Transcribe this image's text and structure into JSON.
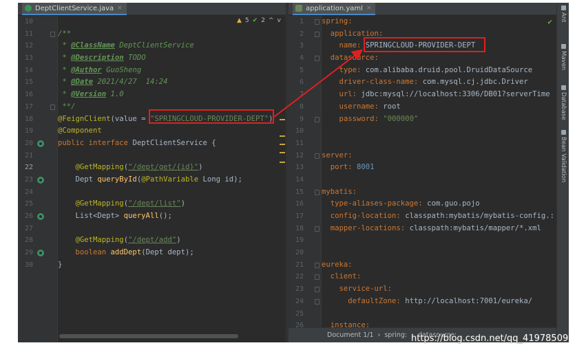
{
  "left_tab": {
    "label": "DeptClientService.java",
    "close": "×"
  },
  "right_tab": {
    "label": "application.yaml",
    "close": "×"
  },
  "inspections": {
    "warnings": "5",
    "ok": "2",
    "up": "^",
    "down": "v"
  },
  "right_check": "✔",
  "java_lines": [
    {
      "n": "10",
      "parts": []
    },
    {
      "n": "11",
      "parts": [
        {
          "c": "c-doc",
          "t": "/**"
        }
      ]
    },
    {
      "n": "12",
      "parts": [
        {
          "c": "c-doc",
          "t": " * "
        },
        {
          "c": "c-tag",
          "t": "@ClassName"
        },
        {
          "c": "c-doc",
          "t": " DeptClientService"
        }
      ]
    },
    {
      "n": "13",
      "parts": [
        {
          "c": "c-doc",
          "t": " * "
        },
        {
          "c": "c-tag",
          "t": "@Description"
        },
        {
          "c": "c-doc",
          "t": " TODO"
        }
      ]
    },
    {
      "n": "14",
      "parts": [
        {
          "c": "c-doc",
          "t": " * "
        },
        {
          "c": "c-tag",
          "t": "@Author"
        },
        {
          "c": "c-doc",
          "t": " GuoSheng"
        }
      ]
    },
    {
      "n": "15",
      "parts": [
        {
          "c": "c-doc",
          "t": " * "
        },
        {
          "c": "c-tag",
          "t": "@Date"
        },
        {
          "c": "c-doc",
          "t": " 2021/4/27  14:24"
        }
      ]
    },
    {
      "n": "16",
      "parts": [
        {
          "c": "c-doc",
          "t": " * "
        },
        {
          "c": "c-tag",
          "t": "@Version"
        },
        {
          "c": "c-doc",
          "t": " 1.0"
        }
      ]
    },
    {
      "n": "17",
      "parts": [
        {
          "c": "c-doc",
          "t": " **/"
        }
      ]
    },
    {
      "n": "18",
      "parts": [
        {
          "c": "c-ann",
          "t": "@FeignClient"
        },
        {
          "c": "",
          "t": "(value = "
        },
        {
          "c": "c-str",
          "t": "\"SPRINGCLOUD-PROVIDER-DEPT\""
        },
        {
          "c": "",
          "t": ")"
        }
      ]
    },
    {
      "n": "19",
      "parts": [
        {
          "c": "c-ann",
          "t": "@Component"
        }
      ]
    },
    {
      "n": "20",
      "icon": true,
      "parts": [
        {
          "c": "c-kw",
          "t": "public interface "
        },
        {
          "c": "",
          "t": "DeptClientService {"
        }
      ]
    },
    {
      "n": "21",
      "parts": []
    },
    {
      "n": "22",
      "cur": true,
      "parts": [
        {
          "c": "",
          "t": "    "
        },
        {
          "c": "c-ann",
          "t": "@GetMapping"
        },
        {
          "c": "",
          "t": "("
        },
        {
          "c": "c-link",
          "t": "\"/dept/get/{id}\""
        },
        {
          "c": "",
          "t": ")"
        }
      ]
    },
    {
      "n": "23",
      "icon": true,
      "parts": [
        {
          "c": "",
          "t": "    Dept "
        },
        {
          "c": "c-fn",
          "t": "queryById"
        },
        {
          "c": "",
          "t": "("
        },
        {
          "c": "c-ann",
          "t": "@PathVariable"
        },
        {
          "c": "",
          "t": " Long id);"
        }
      ]
    },
    {
      "n": "24",
      "parts": []
    },
    {
      "n": "25",
      "parts": [
        {
          "c": "",
          "t": "    "
        },
        {
          "c": "c-ann",
          "t": "@GetMapping"
        },
        {
          "c": "",
          "t": "("
        },
        {
          "c": "c-link",
          "t": "\"/dept/list\""
        },
        {
          "c": "",
          "t": ")"
        }
      ]
    },
    {
      "n": "26",
      "icon": true,
      "parts": [
        {
          "c": "",
          "t": "    List<Dept> "
        },
        {
          "c": "c-fn",
          "t": "queryAll"
        },
        {
          "c": "",
          "t": "();"
        }
      ]
    },
    {
      "n": "27",
      "parts": []
    },
    {
      "n": "28",
      "parts": [
        {
          "c": "",
          "t": "    "
        },
        {
          "c": "c-ann",
          "t": "@GetMapping"
        },
        {
          "c": "",
          "t": "("
        },
        {
          "c": "c-link",
          "t": "\"/dept/add\""
        },
        {
          "c": "",
          "t": ")"
        }
      ]
    },
    {
      "n": "29",
      "icon": true,
      "parts": [
        {
          "c": "",
          "t": "    "
        },
        {
          "c": "c-kw",
          "t": "boolean "
        },
        {
          "c": "c-fn",
          "t": "addDept"
        },
        {
          "c": "",
          "t": "(Dept dept);"
        }
      ]
    },
    {
      "n": "30",
      "parts": [
        {
          "c": "",
          "t": "}"
        }
      ]
    }
  ],
  "yaml_lines": [
    {
      "n": "1",
      "parts": [
        {
          "c": "c-key",
          "t": "spring:"
        }
      ]
    },
    {
      "n": "2",
      "parts": [
        {
          "c": "c-key",
          "t": "  application:"
        }
      ]
    },
    {
      "n": "3",
      "parts": [
        {
          "c": "c-key",
          "t": "    name: "
        },
        {
          "c": "c-val",
          "t": "SPRINGCLOUD-PROVIDER-DEPT"
        }
      ]
    },
    {
      "n": "4",
      "parts": [
        {
          "c": "c-key",
          "t": "  datasource:"
        }
      ]
    },
    {
      "n": "5",
      "parts": [
        {
          "c": "c-key",
          "t": "    type: "
        },
        {
          "c": "c-val",
          "t": "com.alibaba.druid.pool.DruidDataSource"
        }
      ]
    },
    {
      "n": "6",
      "parts": [
        {
          "c": "c-key",
          "t": "    driver-class-name: "
        },
        {
          "c": "c-val",
          "t": "com.mysql.cj.jdbc.Driver"
        }
      ]
    },
    {
      "n": "7",
      "parts": [
        {
          "c": "c-key",
          "t": "    url: "
        },
        {
          "c": "c-val",
          "t": "jdbc:mysql://localhost:3306/DB01?serverTime"
        }
      ]
    },
    {
      "n": "8",
      "parts": [
        {
          "c": "c-key",
          "t": "    username: "
        },
        {
          "c": "c-val",
          "t": "root"
        }
      ]
    },
    {
      "n": "9",
      "parts": [
        {
          "c": "c-key",
          "t": "    password: "
        },
        {
          "c": "c-str",
          "t": "\"000000\""
        }
      ]
    },
    {
      "n": "10",
      "parts": []
    },
    {
      "n": "11",
      "parts": []
    },
    {
      "n": "12",
      "parts": [
        {
          "c": "c-key",
          "t": "server:"
        }
      ]
    },
    {
      "n": "13",
      "parts": [
        {
          "c": "c-key",
          "t": "  port: "
        },
        {
          "c": "c-num",
          "t": "8001"
        }
      ]
    },
    {
      "n": "14",
      "parts": []
    },
    {
      "n": "15",
      "parts": [
        {
          "c": "c-key",
          "t": "mybatis:"
        }
      ]
    },
    {
      "n": "16",
      "parts": [
        {
          "c": "c-key",
          "t": "  type-aliases-package: "
        },
        {
          "c": "c-val",
          "t": "com.guo.pojo"
        }
      ]
    },
    {
      "n": "17",
      "parts": [
        {
          "c": "c-key",
          "t": "  config-location: "
        },
        {
          "c": "c-val",
          "t": "classpath:mybatis/mybatis-config.:"
        }
      ]
    },
    {
      "n": "18",
      "parts": [
        {
          "c": "c-key",
          "t": "  mapper-locations: "
        },
        {
          "c": "c-val",
          "t": "classpath:mybatis/mapper/*.xml"
        }
      ]
    },
    {
      "n": "19",
      "parts": []
    },
    {
      "n": "20",
      "parts": []
    },
    {
      "n": "21",
      "parts": [
        {
          "c": "c-key",
          "t": "eureka:"
        }
      ]
    },
    {
      "n": "22",
      "parts": [
        {
          "c": "c-key",
          "t": "  client:"
        }
      ]
    },
    {
      "n": "23",
      "parts": [
        {
          "c": "c-key",
          "t": "    service-url:"
        }
      ]
    },
    {
      "n": "24",
      "parts": [
        {
          "c": "c-key",
          "t": "      defaultZone: "
        },
        {
          "c": "c-val",
          "t": "http://localhost:7001/eureka/"
        }
      ]
    },
    {
      "n": "25",
      "parts": []
    },
    {
      "n": "26",
      "parts": [
        {
          "c": "c-key",
          "t": "  instance:"
        }
      ]
    }
  ],
  "right_toolbar": [
    {
      "label": "Ant",
      "icon": "ant-icon"
    },
    {
      "label": "Maven",
      "icon": "maven-icon"
    },
    {
      "label": "Database",
      "icon": "database-icon"
    },
    {
      "label": "Bean Validation",
      "icon": "bean-validation-icon"
    }
  ],
  "status": {
    "document": "Document 1/1",
    "sep": "›",
    "crumb1": "spring:",
    "crumb2": "datasource:"
  },
  "watermark": "https://blog.csdn.net/qq_41978509"
}
